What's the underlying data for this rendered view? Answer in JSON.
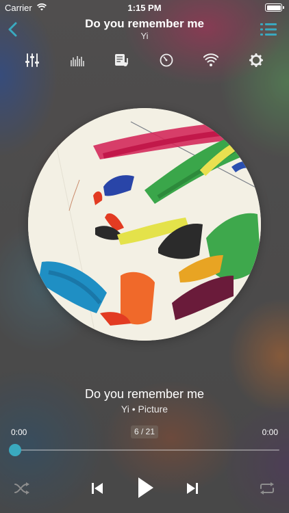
{
  "status_bar": {
    "carrier": "Carrier",
    "time": "1:15 PM"
  },
  "nav": {
    "title": "Do you remember me",
    "subtitle": "Yi",
    "back_icon": "chevron-left-icon",
    "playlist_icon": "list-icon"
  },
  "toolbar": {
    "icons": [
      "equalizer-sliders-icon",
      "spectrum-icon",
      "queue-music-icon",
      "sleep-timer-icon",
      "wifi-icon",
      "settings-gear-icon"
    ]
  },
  "artwork": {
    "description_icon": "album-art"
  },
  "song": {
    "title": "Do you remember me",
    "meta": "Yi • Picture"
  },
  "playback": {
    "elapsed": "0:00",
    "total": "0:00",
    "track_counter": "6 / 21",
    "progress": 0.0
  },
  "controls": {
    "shuffle_icon": "shuffle-icon",
    "previous_icon": "previous-track-icon",
    "play_icon": "play-icon",
    "next_icon": "next-track-icon",
    "repeat_icon": "repeat-icon"
  },
  "colors": {
    "accent": "#3aa9bf",
    "counter_bg": "#786e64"
  }
}
